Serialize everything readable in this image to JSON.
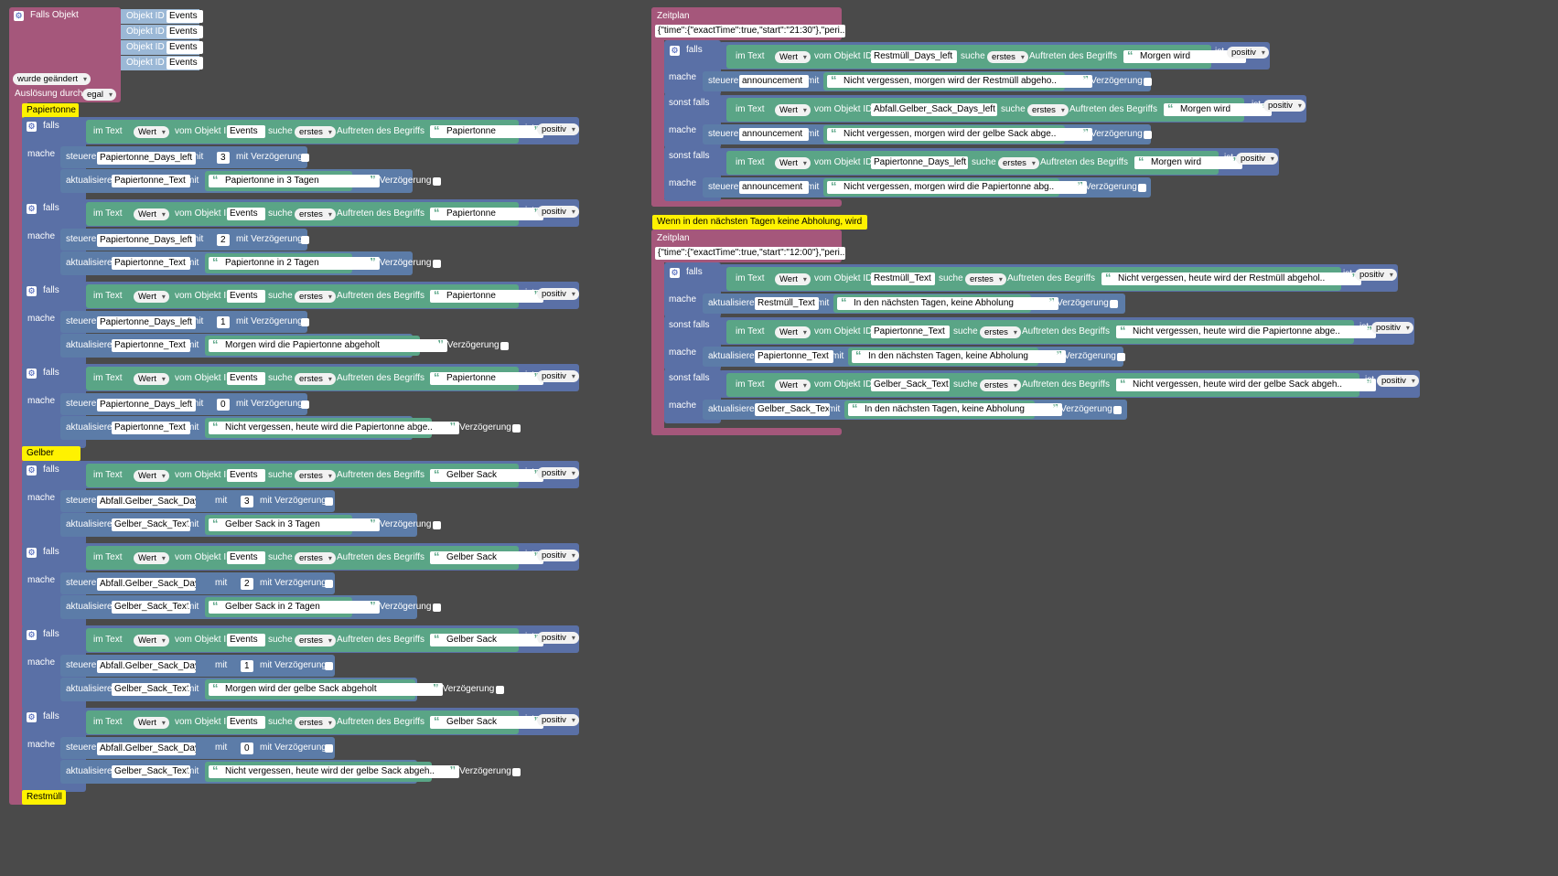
{
  "trigger": {
    "title": "Falls Objekt",
    "objects": [
      {
        "prefix": "Objekt ID",
        "id": "Events"
      },
      {
        "prefix": "Objekt ID",
        "id": "Events"
      },
      {
        "prefix": "Objekt ID",
        "id": "Events"
      },
      {
        "prefix": "Objekt ID",
        "id": "Events"
      }
    ],
    "changed": "wurde geändert",
    "triggered_by_label": "Auslösung durch",
    "triggered_by_value": "egal"
  },
  "labels": {
    "falls": "falls",
    "mache": "mache",
    "sonst_falls": "sonst falls",
    "im_text": "im Text",
    "wert": "Wert",
    "vom_objekt_id": "vom Objekt ID",
    "suche": "suche",
    "erstes": "erstes",
    "auftreten": "Auftreten des Begriffs",
    "ist": "ist",
    "positiv": "positiv",
    "steuere": "steuere",
    "aktualisiere": "aktualisiere",
    "mit": "mit",
    "mit_verzoegerung": "mit Verzögerung"
  },
  "groups": [
    {
      "comment": "Papiertonne",
      "blocks": [
        {
          "object": "Events",
          "search": "Papiertonne",
          "steuere_var": "Papiertonne_Days_left",
          "steuere_val": "3",
          "akt_var": "Papiertonne_Text",
          "akt_text": "Papiertonne in 3 Tagen"
        },
        {
          "object": "Events",
          "search": "Papiertonne",
          "steuere_var": "Papiertonne_Days_left",
          "steuere_val": "2",
          "akt_var": "Papiertonne_Text",
          "akt_text": "Papiertonne in 2 Tagen"
        },
        {
          "object": "Events",
          "search": "Papiertonne",
          "steuere_var": "Papiertonne_Days_left",
          "steuere_val": "1",
          "akt_var": "Papiertonne_Text",
          "akt_text": "Morgen wird die Papiertonne abgeholt"
        },
        {
          "object": "Events",
          "search": "Papiertonne",
          "steuere_var": "Papiertonne_Days_left",
          "steuere_val": "0",
          "akt_var": "Papiertonne_Text",
          "akt_text": "Nicht vergessen, heute wird die Papiertonne abge.."
        }
      ]
    },
    {
      "comment": "Gelber Sack",
      "blocks": [
        {
          "object": "Events",
          "search": "Gelber Sack",
          "steuere_var": "Abfall.Gelber_Sack_Days_left",
          "steuere_val": "3",
          "akt_var": "Gelber_Sack_Text",
          "akt_text": "Gelber Sack in 3 Tagen"
        },
        {
          "object": "Events",
          "search": "Gelber Sack",
          "steuere_var": "Abfall.Gelber_Sack_Days_left",
          "steuere_val": "2",
          "akt_var": "Gelber_Sack_Text",
          "akt_text": "Gelber Sack in 2 Tagen"
        },
        {
          "object": "Events",
          "search": "Gelber Sack",
          "steuere_var": "Abfall.Gelber_Sack_Days_left",
          "steuere_val": "1",
          "akt_var": "Gelber_Sack_Text",
          "akt_text": "Morgen wird der gelbe Sack abgeholt"
        },
        {
          "object": "Events",
          "search": "Gelber Sack",
          "steuere_var": "Abfall.Gelber_Sack_Days_left",
          "steuere_val": "0",
          "akt_var": "Gelber_Sack_Text",
          "akt_text": "Nicht vergessen, heute wird der gelbe Sack abgeh.."
        }
      ]
    }
  ],
  "bottom_comment": "Restmüll",
  "schedule1": {
    "title": "Zeitplan",
    "cron": "{\"time\":{\"exactTime\":true,\"start\":\"21:30\"},\"peri..",
    "blocks": [
      {
        "head": "falls",
        "object": "Restmüll_Days_left",
        "search": "Morgen wird",
        "var": "announcement",
        "text": "Nicht vergessen, morgen wird der Restmüll abgeho.."
      },
      {
        "head": "sonst falls",
        "object": "Abfall.Gelber_Sack_Days_left",
        "search": "Morgen wird",
        "var": "announcement",
        "text": "Nicht vergessen, morgen wird der gelbe Sack abge.."
      },
      {
        "head": "sonst falls",
        "object": "Papiertonne_Days_left",
        "search": "Morgen wird",
        "var": "announcement",
        "text": "Nicht vergessen, morgen wird die Papiertonne abg.."
      }
    ]
  },
  "mid_comment": "Wenn in den nächsten Tagen keine Abholung, wird ...",
  "schedule2": {
    "title": "Zeitplan",
    "cron": "{\"time\":{\"exactTime\":true,\"start\":\"12:00\"},\"peri..",
    "blocks": [
      {
        "head": "falls",
        "object": "Restmüll_Text",
        "search": "Nicht vergessen, heute wird der Restmüll abgehol..",
        "var": "Restmüll_Text",
        "text": "In den nächsten Tagen, keine Abholung"
      },
      {
        "head": "sonst falls",
        "object": "Papiertonne_Text",
        "search": "Nicht vergessen, heute wird die Papiertonne abge..",
        "var": "Papiertonne_Text",
        "text": "In den nächsten Tagen, keine Abholung"
      },
      {
        "head": "sonst falls",
        "object": "Gelber_Sack_Text",
        "search": "Nicht vergessen, heute wird der gelbe Sack abgeh..",
        "var": "Gelber_Sack_Text",
        "text": "In den nächsten Tagen, keine Abholung"
      }
    ]
  },
  "colors": {
    "trigger": "#a5577b",
    "if_block": "#5a70a6",
    "text_block": "#5aa586",
    "action_block": "#5c7ca8",
    "comment": "#fff200",
    "workspace": "#4a4a4a"
  }
}
